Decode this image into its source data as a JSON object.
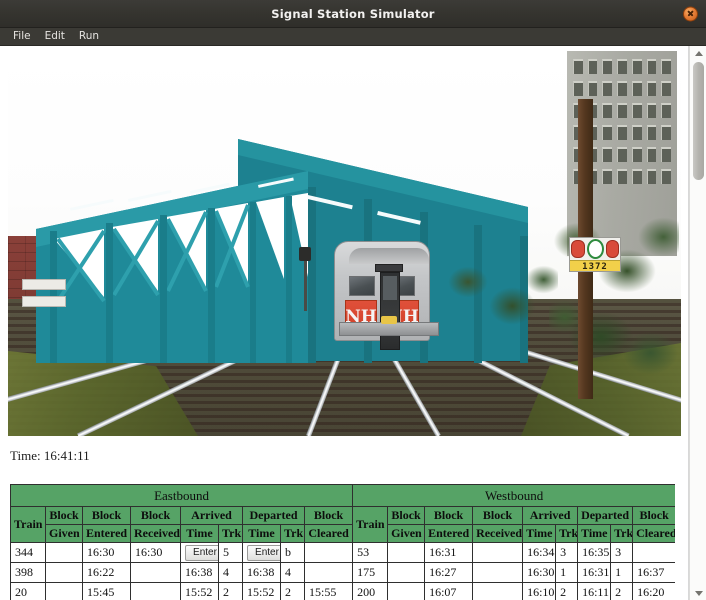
{
  "window": {
    "title": "Signal Station Simulator",
    "close_icon": "close-icon"
  },
  "menubar": {
    "items": [
      {
        "label": "File"
      },
      {
        "label": "Edit"
      },
      {
        "label": "Run"
      }
    ]
  },
  "viewport": {
    "scene_description": "Railway signal station simulator 3D view: double-track mainline passing under a teal steel truss bridge, an NH commuter train approaching on the right track, brick retaining wall at left, grey office building and utility pole with signs at right",
    "train": {
      "logo_left": "NH",
      "logo_right": "NH"
    },
    "pole_sign": {
      "number": "1372"
    }
  },
  "status": {
    "time_label": "Time: 16:41:11"
  },
  "log_table": {
    "directions": [
      {
        "label": "Eastbound"
      },
      {
        "label": "Westbound"
      }
    ],
    "group_headers": [
      {
        "label": "Arrived"
      },
      {
        "label": "Departed"
      }
    ],
    "columns": [
      "Train",
      "Block Given",
      "Block Entered",
      "Block Received",
      "Time",
      "Trk",
      "Time",
      "Trk",
      "Block Cleared"
    ],
    "column_parts": {
      "train": "Train",
      "block": "Block",
      "given": "Given",
      "entered": "Entered",
      "received": "Received",
      "time": "Time",
      "trk": "Trk",
      "cleared": "Cleared"
    },
    "rows": [
      {
        "eastbound": {
          "train": "344",
          "block_given": "",
          "block_entered": "16:30",
          "block_received": "16:30",
          "arrived_time": "Enter",
          "arrived_time_is_button": true,
          "arrived_trk": "5",
          "departed_time": "Enter",
          "departed_time_is_button": true,
          "departed_trk": "b",
          "block_cleared": ""
        },
        "westbound": {
          "train": "53",
          "block_given": "",
          "block_entered": "16:31",
          "block_received": "",
          "arrived_time": "16:34",
          "arrived_trk": "3",
          "departed_time": "16:35",
          "departed_trk": "3",
          "block_cleared": ""
        }
      },
      {
        "eastbound": {
          "train": "398",
          "block_given": "",
          "block_entered": "16:22",
          "block_received": "",
          "arrived_time": "16:38",
          "arrived_trk": "4",
          "departed_time": "16:38",
          "departed_trk": "4",
          "block_cleared": ""
        },
        "westbound": {
          "train": "175",
          "block_given": "",
          "block_entered": "16:27",
          "block_received": "",
          "arrived_time": "16:30",
          "arrived_trk": "1",
          "departed_time": "16:31",
          "departed_trk": "1",
          "block_cleared": "16:37"
        }
      },
      {
        "eastbound": {
          "train": "20",
          "block_given": "",
          "block_entered": "15:45",
          "block_received": "",
          "arrived_time": "15:52",
          "arrived_trk": "2",
          "departed_time": "15:52",
          "departed_trk": "2",
          "block_cleared": "15:55"
        },
        "westbound": {
          "train": "200",
          "block_given": "",
          "block_entered": "16:07",
          "block_received": "",
          "arrived_time": "16:10",
          "arrived_trk": "2",
          "departed_time": "16:11",
          "departed_trk": "2",
          "block_cleared": "16:20"
        }
      }
    ]
  },
  "colors": {
    "titlebar_bg": "#35342f",
    "menubar_bg": "#3b3a35",
    "close_button": "#e8813a",
    "table_header_green": "#56a366",
    "bridge_teal": "#1f8a99",
    "train_red": "#cf4027",
    "brick_red": "#7d3a33"
  },
  "scrollbar": {
    "up_arrow_icon": "chevron-up-icon",
    "down_arrow_icon": "chevron-down-icon"
  }
}
